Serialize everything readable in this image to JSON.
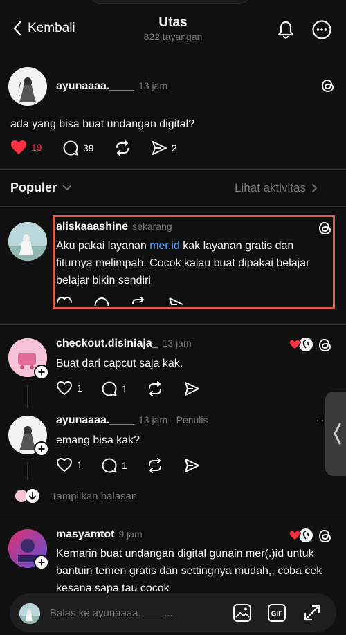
{
  "header": {
    "back_label": "Kembali",
    "title": "Utas",
    "views": "822 tayangan"
  },
  "main_post": {
    "username": "ayunaaaa.____",
    "time": "13 jam",
    "text": "ada yang bisa buat undangan digital?",
    "likes": "19",
    "replies": "39",
    "shares": "2"
  },
  "sort": {
    "label": "Populer",
    "activity_label": "Lihat aktivitas"
  },
  "replies": [
    {
      "username": "aliskaaashine",
      "time": "sekarang",
      "text_before_link": "Aku pakai layanan ",
      "link": "mer.id",
      "text_after_link": " kak layanan gratis dan fiturnya melimpah. Cocok kalau buat dipakai belajar belajar bikin sendiri"
    },
    {
      "username": "checkout.disiniaja_",
      "time": "13 jam",
      "text": "Buat dari capcut saja kak.",
      "likes": "1",
      "replies": "1"
    },
    {
      "username": "ayunaaaa.____",
      "time": "13 jam",
      "author_tag": "· Penulis",
      "text": "emang bisa kak?",
      "likes": "1",
      "replies": "1"
    },
    {
      "username": "masyamtot",
      "time": "9 jam",
      "text": "Kemarin buat undangan digital gunain mer(.)id untuk bantuin temen gratis dan settingnya mudah,, coba cek kesana sapa tau cocok"
    }
  ],
  "show_replies_label": "Tampilkan balasan",
  "composer": {
    "placeholder": "Balas ke ayunaaaa.____..."
  },
  "colors": {
    "background": "#101010",
    "like_red": "#ff3040",
    "link_blue": "#4aa3ff",
    "highlight_border": "#d8604a"
  }
}
